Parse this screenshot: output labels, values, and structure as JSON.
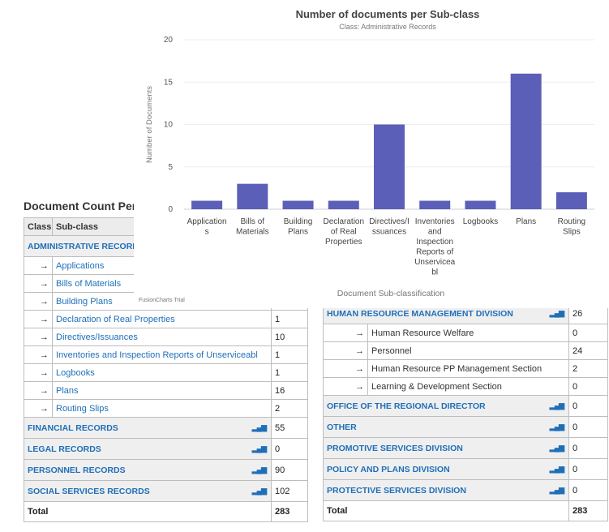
{
  "left_panel": {
    "heading": "Document Count Per C",
    "headers": [
      "Class",
      "Sub-class",
      ""
    ],
    "classes": [
      {
        "name": "ADMINISTRATIVE RECORDS",
        "count": "",
        "subs": [
          {
            "name": "Applications",
            "count": ""
          },
          {
            "name": "Bills of Materials",
            "count": ""
          },
          {
            "name": "Building Plans",
            "count": ""
          },
          {
            "name": "Declaration of Real Properties",
            "count": "1"
          },
          {
            "name": "Directives/Issuances",
            "count": "10"
          },
          {
            "name": "Inventories and Inspection Reports of Unserviceabl",
            "count": "1"
          },
          {
            "name": "Logbooks",
            "count": "1"
          },
          {
            "name": "Plans",
            "count": "16"
          },
          {
            "name": "Routing Slips",
            "count": "2"
          }
        ]
      },
      {
        "name": "FINANCIAL RECORDS",
        "count": "55",
        "subs": []
      },
      {
        "name": "LEGAL RECORDS",
        "count": "0",
        "subs": []
      },
      {
        "name": "PERSONNEL RECORDS",
        "count": "90",
        "subs": []
      },
      {
        "name": "SOCIAL SERVICES RECORDS",
        "count": "102",
        "subs": []
      }
    ],
    "total_label": "Total",
    "total_value": "283"
  },
  "right_panel": {
    "classes": [
      {
        "name": "HUMAN RESOURCE MANAGEMENT DIVISION",
        "count": "26",
        "subs": [
          {
            "name": "Human Resource Welfare",
            "count": "0"
          },
          {
            "name": "Personnel",
            "count": "24"
          },
          {
            "name": "Human Resource PP Management Section",
            "count": "2"
          },
          {
            "name": "Learning & Development Section",
            "count": "0"
          }
        ]
      },
      {
        "name": "OFFICE OF THE REGIONAL DIRECTOR",
        "count": "0",
        "subs": []
      },
      {
        "name": "OTHER",
        "count": "0",
        "subs": []
      },
      {
        "name": "PROMOTIVE SERVICES DIVISION",
        "count": "0",
        "subs": []
      },
      {
        "name": "POLICY AND PLANS DIVISION",
        "count": "0",
        "subs": []
      },
      {
        "name": "PROTECTIVE SERVICES DIVISION",
        "count": "0",
        "subs": []
      }
    ],
    "total_label": "Total",
    "total_value": "283"
  },
  "icons": {
    "arrow": "→",
    "chart": "chart-icon"
  },
  "colors": {
    "bar": "#5b5fb7",
    "link": "#1f6fb8",
    "row_bg": "#efefef"
  },
  "chart_watermark": "FusionCharts Trial",
  "chart_data": {
    "type": "bar",
    "title": "Number of documents per Sub-class",
    "subtitle": "Class: Administrative Records",
    "xlabel": "Document Sub-classification",
    "ylabel": "Number of Documents",
    "ylim": [
      0,
      20
    ],
    "yticks": [
      0,
      5,
      10,
      15,
      20
    ],
    "grid": true,
    "categories": [
      "Applications",
      "Bills of Materials",
      "Building Plans",
      "Declaration of Real Properties",
      "Directives/Issuances",
      "Inventories and Inspection Reports of Unserviceabl",
      "Logbooks",
      "Plans",
      "Routing Slips"
    ],
    "category_label_lines": [
      [
        "Application",
        "s"
      ],
      [
        "Bills of",
        "Materials"
      ],
      [
        "Building",
        "Plans"
      ],
      [
        "Declaration",
        "of Real",
        "Properties"
      ],
      [
        "Directives/I",
        "ssuances"
      ],
      [
        "Inventories",
        "and",
        "Inspection",
        "Reports of",
        "Unservicea",
        "bl"
      ],
      [
        "Logbooks"
      ],
      [
        "Plans"
      ],
      [
        "Routing",
        "Slips"
      ]
    ],
    "values": [
      1,
      3,
      1,
      1,
      10,
      1,
      1,
      16,
      2
    ]
  }
}
